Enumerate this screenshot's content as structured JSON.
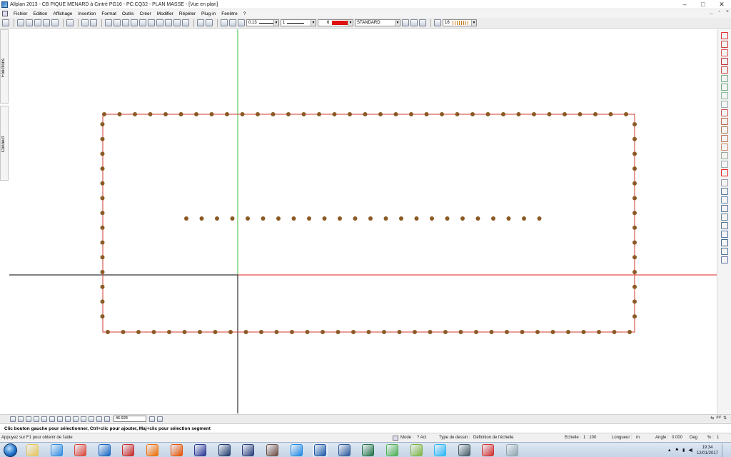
{
  "window": {
    "title": "Allplan 2013 - CB PIQUE MENARD à Cintré PG16 - PC:CQ32 - PLAN MASSE - [Vue en plan]",
    "controls": {
      "minimize": "–",
      "maximize": "□",
      "close": "✕"
    }
  },
  "menu": {
    "items": [
      "Fichier",
      "Edition",
      "Affichage",
      "Insertion",
      "Format",
      "Outils",
      "Créer",
      "Modifier",
      "Répéter",
      "Plug-in",
      "Fenêtre",
      "?"
    ],
    "mdi_controls": [
      "_",
      "▫",
      "×"
    ]
  },
  "toolbar": {
    "pen_thickness": "0.13",
    "line_type": "1",
    "color_number": "6",
    "color_hex": "#e01010",
    "layer": "STANDARD",
    "hatch_number": "16",
    "icons": [
      "new-icon",
      "open-icon",
      "save-icon",
      "print-icon",
      "preview-icon",
      "undo-icon",
      "redo-icon",
      "window-icon",
      "layer-icon",
      "palette-icon"
    ]
  },
  "sidebar_left": {
    "tabs": [
      "Fonctions",
      "Connect"
    ]
  },
  "drawing": {
    "boundary_color": "#d33a2c",
    "point_color": "#8b5a24",
    "crosshair_green": "#3fbf3f",
    "crosshair_red": "#e02020",
    "crosshair_black": "#000000"
  },
  "bottom_toolbar": {
    "coordinate_value": "46.928",
    "right_labels": [
      "⇆",
      "##",
      "⇅"
    ]
  },
  "prompt": {
    "text": "Clic bouton gauche pour sélectionner, Ctrl+clic pour ajouter, Maj+clic pour sélection segment"
  },
  "status": {
    "help": "Appuyez sur F1 pour obtenir de l'aide",
    "mode_label": "Mode :",
    "mode_value": "? Act",
    "type_label": "Type de dessin :",
    "type_value": "Définition de l'échelle",
    "scale_label": "Echelle :",
    "scale_value": "1 : 100",
    "length_label": "Longueur :",
    "length_value": "m",
    "angle_label": "Angle :",
    "angle_value": "0.000",
    "angle_unit": "Deg",
    "percent_label": "% :",
    "percent_value": "1"
  },
  "taskbar": {
    "time": "19:34",
    "date": "12/01/2017",
    "tray_icons": [
      "arrow-up-icon",
      "flag-icon",
      "network-icon",
      "volume-icon"
    ]
  }
}
